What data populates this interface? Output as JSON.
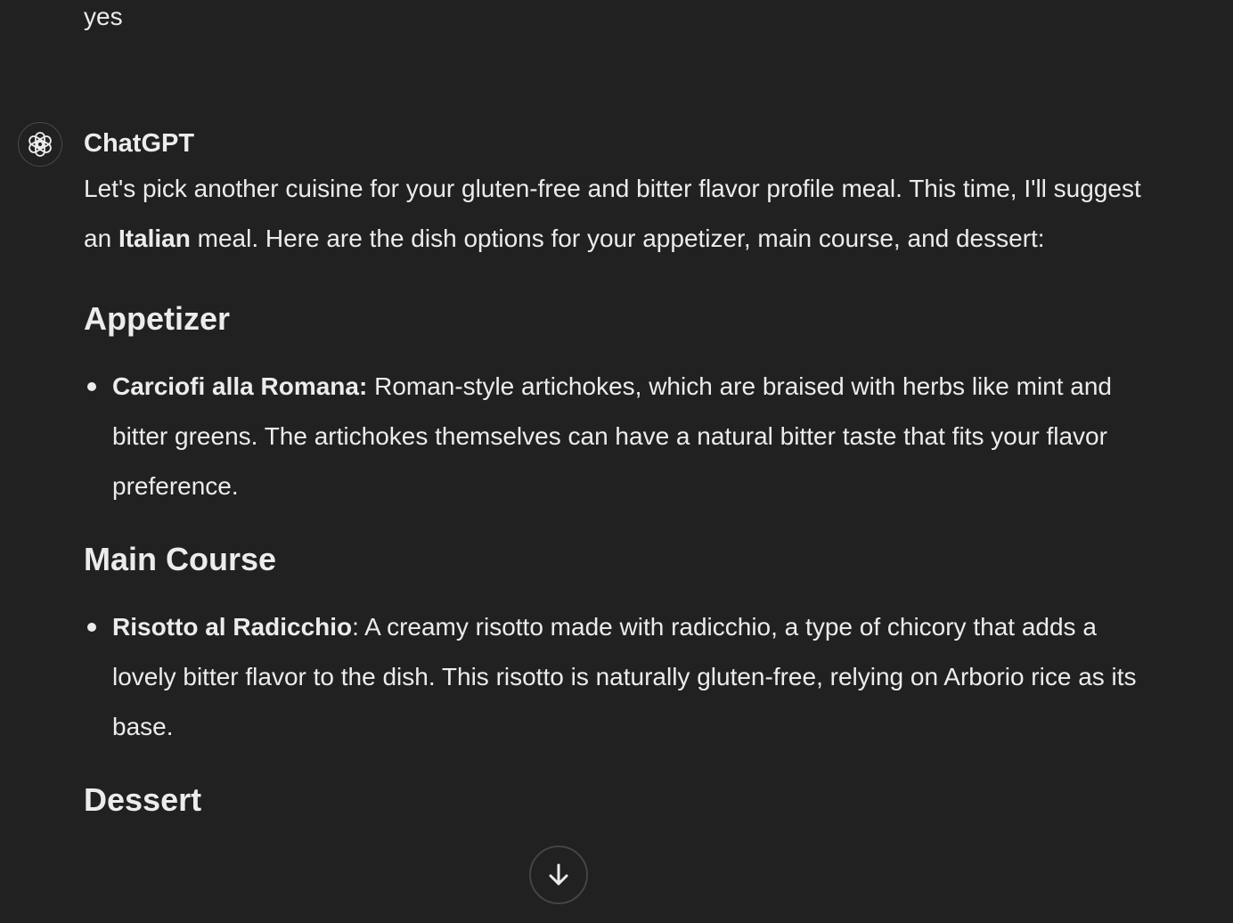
{
  "user_message": {
    "text": "yes"
  },
  "assistant": {
    "avatar_icon": "openai-logo-icon",
    "sender": "ChatGPT",
    "intro": {
      "part1": "Let's pick another cuisine for your gluten-free and bitter flavor profile meal. This time, I'll suggest an ",
      "bold": "Italian",
      "part2": " meal. Here are the dish options for your appetizer, main course, and dessert:"
    },
    "sections": [
      {
        "heading": "Appetizer",
        "items": [
          {
            "name": "Carciofi alla Romana:",
            "description": " Roman-style artichokes, which are braised with herbs like mint and bitter greens. The artichokes themselves can have a natural bitter taste that fits your flavor preference."
          }
        ]
      },
      {
        "heading": "Main Course",
        "items": [
          {
            "name": "Risotto al Radicchio",
            "description": ": A creamy risotto made with radicchio, a type of chicory that adds a lovely bitter flavor to the dish. This risotto is naturally gluten-free, relying on Arborio rice as its base."
          }
        ]
      },
      {
        "heading": "Dessert",
        "items": []
      }
    ]
  },
  "scroll_button": {
    "icon": "arrow-down-icon"
  },
  "colors": {
    "background": "#212121",
    "text": "#ececec",
    "border": "#4a4a4a"
  }
}
